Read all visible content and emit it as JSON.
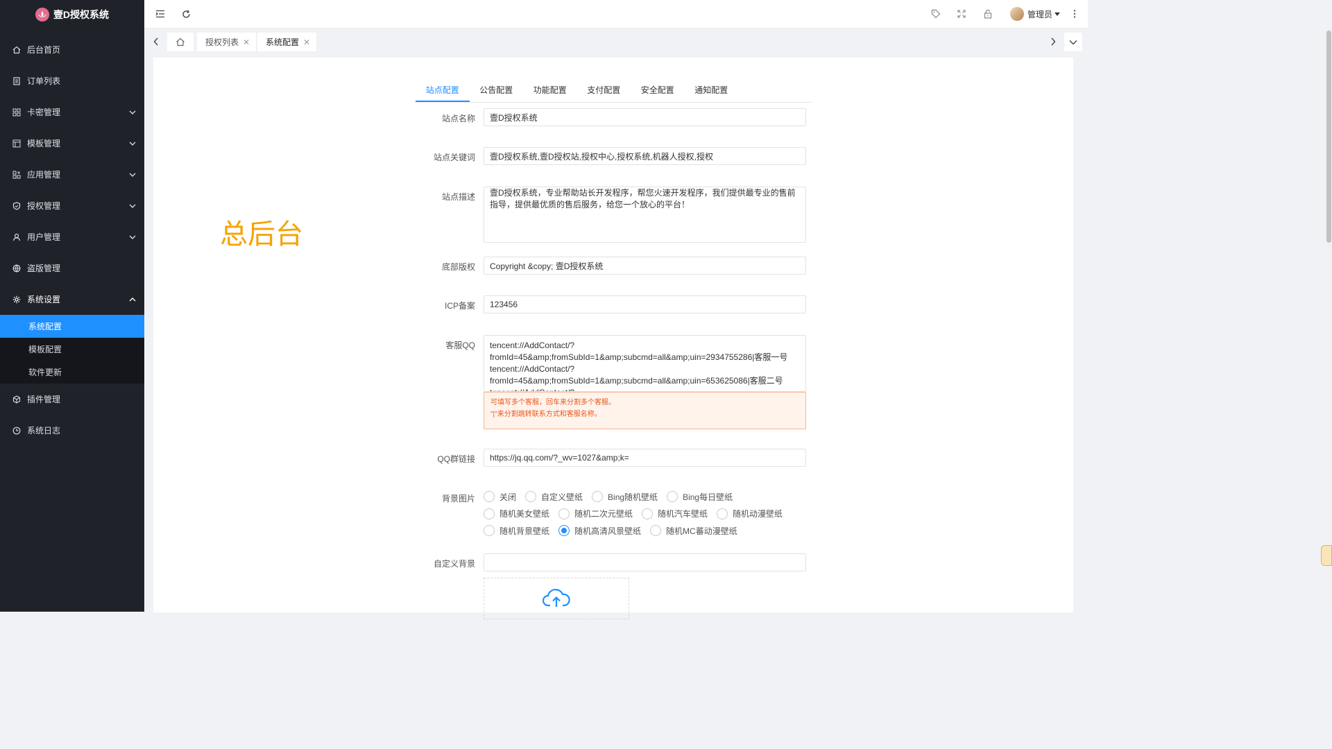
{
  "app": {
    "title": "壹D授权系统"
  },
  "sidebar": {
    "items": [
      {
        "label": "后台首页",
        "icon": "home-icon"
      },
      {
        "label": "订单列表",
        "icon": "document-icon"
      },
      {
        "label": "卡密管理",
        "icon": "grid-icon"
      },
      {
        "label": "模板管理",
        "icon": "template-icon"
      },
      {
        "label": "应用管理",
        "icon": "apps-icon"
      },
      {
        "label": "授权管理",
        "icon": "shield-icon"
      },
      {
        "label": "用户管理",
        "icon": "user-icon"
      },
      {
        "label": "盗版管理",
        "icon": "globe-icon"
      },
      {
        "label": "系统设置",
        "icon": "gear-icon"
      }
    ],
    "sub": [
      {
        "label": "系统配置",
        "active": true
      },
      {
        "label": "模板配置"
      },
      {
        "label": "软件更新"
      }
    ],
    "after": [
      {
        "label": "插件管理",
        "icon": "cube-icon"
      },
      {
        "label": "系统日志",
        "icon": "clock-icon"
      }
    ]
  },
  "topbar": {
    "user_name": "管理员"
  },
  "page_tabs": [
    {
      "label": "授权列表"
    },
    {
      "label": "系统配置"
    }
  ],
  "overlay_text": "总后台",
  "config_tabs": [
    "站点配置",
    "公告配置",
    "功能配置",
    "支付配置",
    "安全配置",
    "通知配置"
  ],
  "form": {
    "site_name": {
      "label": "站点名称",
      "value": "壹D授权系统"
    },
    "keywords": {
      "label": "站点关键词",
      "value": "壹D授权系统,壹D授权站,授权中心,授权系统,机器人授权,授权"
    },
    "description": {
      "label": "站点描述",
      "value": "壹D授权系统，专业帮助站长开发程序，帮您火速开发程序，我们提供最专业的售前指导，提供最优质的售后服务，给您一个放心的平台！"
    },
    "copyright": {
      "label": "底部版权",
      "value": "Copyright &copy; 壹D授权系统"
    },
    "icp": {
      "label": "ICP备案",
      "value": "123456"
    },
    "qq": {
      "label": "客服QQ",
      "value": "tencent://AddContact/?fromId=45&amp;fromSubId=1&amp;subcmd=all&amp;uin=2934755286|客服一号\ntencent://AddContact/?fromId=45&amp;fromSubId=1&amp;subcmd=all&amp;uin=653625086|客服二号\ntencent://AddContact/?",
      "hint1": "可填写多个客服，回车来分割多个客服。",
      "hint2": "\"|\"来分割跳转联系方式和客服名称。"
    },
    "qq_group": {
      "label": "QQ群链接",
      "value": "https://jq.qq.com/?_wv=1027&amp;k="
    },
    "background": {
      "label": "背景图片",
      "options": [
        [
          "关闭",
          "自定义壁纸",
          "Bing随机壁纸",
          "Bing每日壁纸"
        ],
        [
          "随机美女壁纸",
          "随机二次元壁纸",
          "随机汽车壁纸",
          "随机动漫壁纸"
        ],
        [
          "随机背景壁纸",
          "随机高清风景壁纸",
          "随机MC蕃动漫壁纸"
        ]
      ],
      "selected": "随机高清风景壁纸"
    },
    "custom_bg": {
      "label": "自定义背景",
      "value": ""
    }
  },
  "colors": {
    "accent": "#1e90ff",
    "sidebar_bg": "#20222a",
    "overlay": "#f6a200",
    "hint_text": "#e85a1c"
  }
}
